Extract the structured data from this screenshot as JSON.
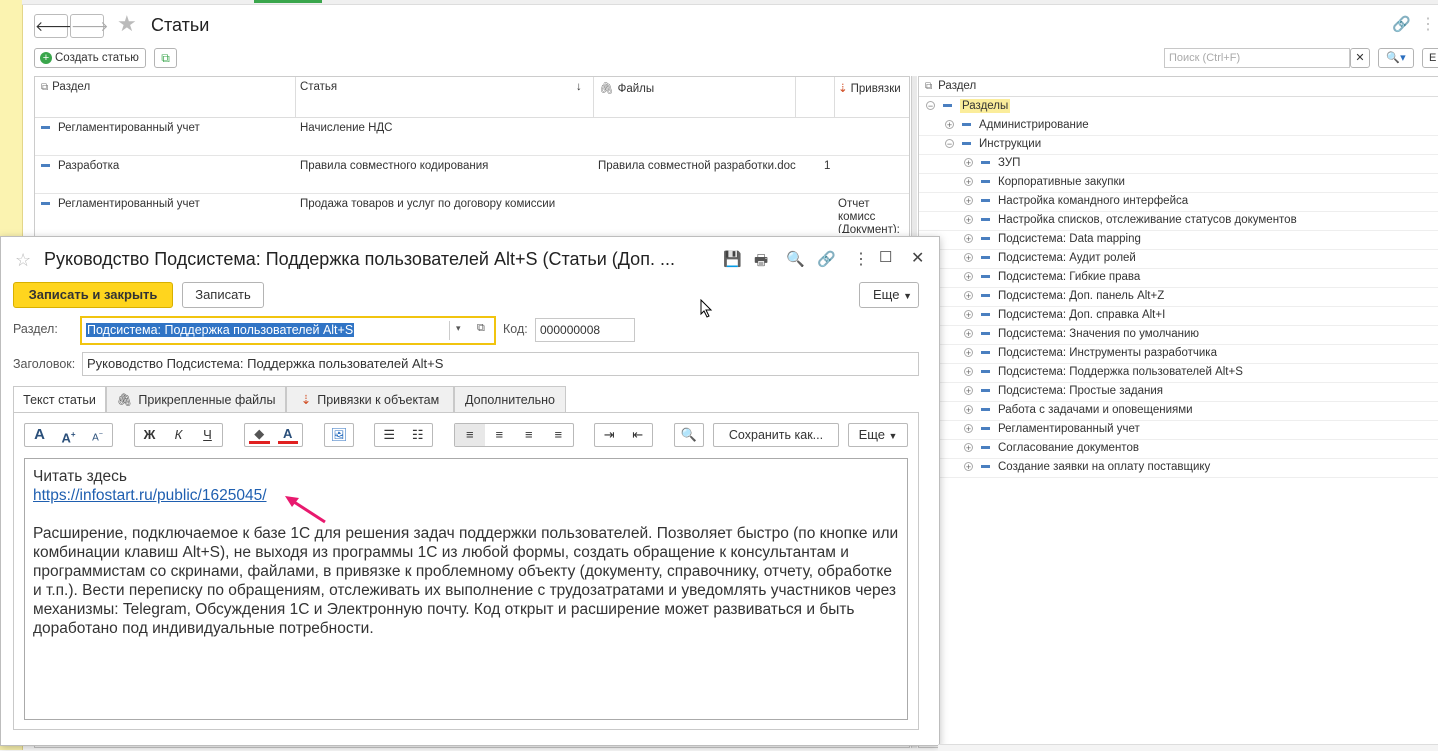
{
  "main": {
    "title": "Статьи",
    "create_label": "Создать статью",
    "search_placeholder": "Поиск (Ctrl+F)",
    "columns": [
      "Раздел",
      "Статья",
      "Файлы",
      "Привязки"
    ],
    "sort_arrow": "↓",
    "rows": [
      {
        "section": "Регламентированный учет",
        "article": "Начисление НДС",
        "files": "",
        "count": "",
        "binding": ""
      },
      {
        "section": "Разработка",
        "article": "Правила совместного кодирования",
        "files": "Правила совместной разработки.doc",
        "count": "1",
        "binding": ""
      },
      {
        "section": "Регламентированный учет",
        "article": "Продажа товаров и услуг по договору комиссии",
        "files": "",
        "count": "",
        "binding": "Отчет комисс (Документ); О"
      }
    ],
    "more_right": "Е"
  },
  "tree": {
    "header": "Раздел",
    "root": "Разделы",
    "items": [
      {
        "label": "Администрирование",
        "level": 1
      },
      {
        "label": "Инструкции",
        "level": 1,
        "open": true
      },
      {
        "label": "ЗУП",
        "level": 2
      },
      {
        "label": "Корпоративные закупки",
        "level": 2
      },
      {
        "label": "Настройка командного интерфейса",
        "level": 2
      },
      {
        "label": "Настройка списков, отслеживание статусов документов",
        "level": 2
      },
      {
        "label": "Подсистема: Data mapping",
        "level": 2
      },
      {
        "label": "Подсистема: Аудит ролей",
        "level": 2
      },
      {
        "label": "Подсистема: Гибкие права",
        "level": 2
      },
      {
        "label": "Подсистема: Доп. панель Alt+Z",
        "level": 2
      },
      {
        "label": "Подсистема: Доп. справка Alt+I",
        "level": 2
      },
      {
        "label": "Подсистема: Значения по умолчанию",
        "level": 2
      },
      {
        "label": "Подсистема: Инструменты разработчика",
        "level": 2
      },
      {
        "label": "Подсистема: Поддержка пользователей Alt+S",
        "level": 2
      },
      {
        "label": "Подсистема: Простые задания",
        "level": 2
      },
      {
        "label": "Работа с задачами и оповещениями",
        "level": 2
      },
      {
        "label": "Регламентированный учет",
        "level": 2
      },
      {
        "label": "Согласование документов",
        "level": 2
      },
      {
        "label": "Создание заявки на оплату поставщику",
        "level": 2
      }
    ]
  },
  "dialog": {
    "title": "Руководство Подсистема: Поддержка пользователей Alt+S (Статьи (Доп. ...",
    "save_close": "Записать и закрыть",
    "save": "Записать",
    "more": "Еще",
    "section_label": "Раздел:",
    "section_value": "Подсистема: Поддержка пользователей Alt+S",
    "code_label": "Код:",
    "code_value": "000000008",
    "heading_label": "Заголовок:",
    "heading_value": "Руководство Подсистема: Поддержка пользователей Alt+S",
    "tabs": [
      "Текст статьи",
      "Прикрепленные файлы",
      "Привязки к объектам",
      "Дополнительно"
    ],
    "save_as": "Сохранить как...",
    "editor_more": "Еще",
    "body_line1": "Читать здесь",
    "body_link": "https://infostart.ru/public/1625045/",
    "body_paragraph": "Расширение, подключаемое к базе 1С для решения задач поддержки пользователей. Позволяет быстро (по кнопке или комбинации клавиш Alt+S), не выходя из программы 1С из любой формы, создать обращение к консультантам и программистам со скринами, файлами, в привязке к проблемному объекту (документу, справочнику, отчету, обработке и т.п.). Вести переписку по обращениям, отслеживать их выполнение с трудозатратами и уведомлять участников через механизмы: Telegram, Обсуждения 1С и Электронную почту. Код открыт и расширение может развиваться и быть доработано под индивидуальные потребности."
  },
  "colors": {
    "accent_yellow": "#ffd51e",
    "link": "#1f5fb0",
    "arrow": "#e8196e"
  }
}
